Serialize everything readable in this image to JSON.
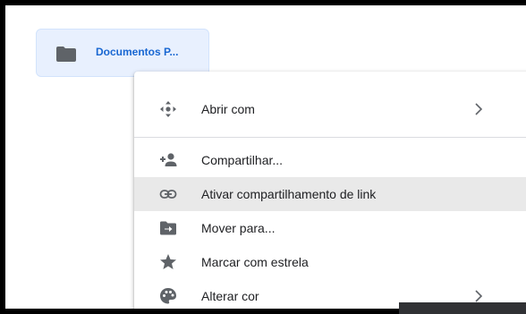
{
  "folder": {
    "name": "Documentos P...",
    "icon": "folder-icon",
    "accent": "#1967d2"
  },
  "context_menu": {
    "items": [
      {
        "label": "Abrir com",
        "icon": "move-arrows-icon",
        "has_submenu": true
      },
      {
        "label": "Compartilhar...",
        "icon": "add-person-icon",
        "has_submenu": false
      },
      {
        "label": "Ativar compartilhamento de link",
        "icon": "link-icon",
        "has_submenu": false,
        "highlighted": true
      },
      {
        "label": "Mover para...",
        "icon": "move-to-folder-icon",
        "has_submenu": false
      },
      {
        "label": "Marcar com estrela",
        "icon": "star-icon",
        "has_submenu": false
      },
      {
        "label": "Alterar cor",
        "icon": "palette-icon",
        "has_submenu": true
      }
    ]
  }
}
